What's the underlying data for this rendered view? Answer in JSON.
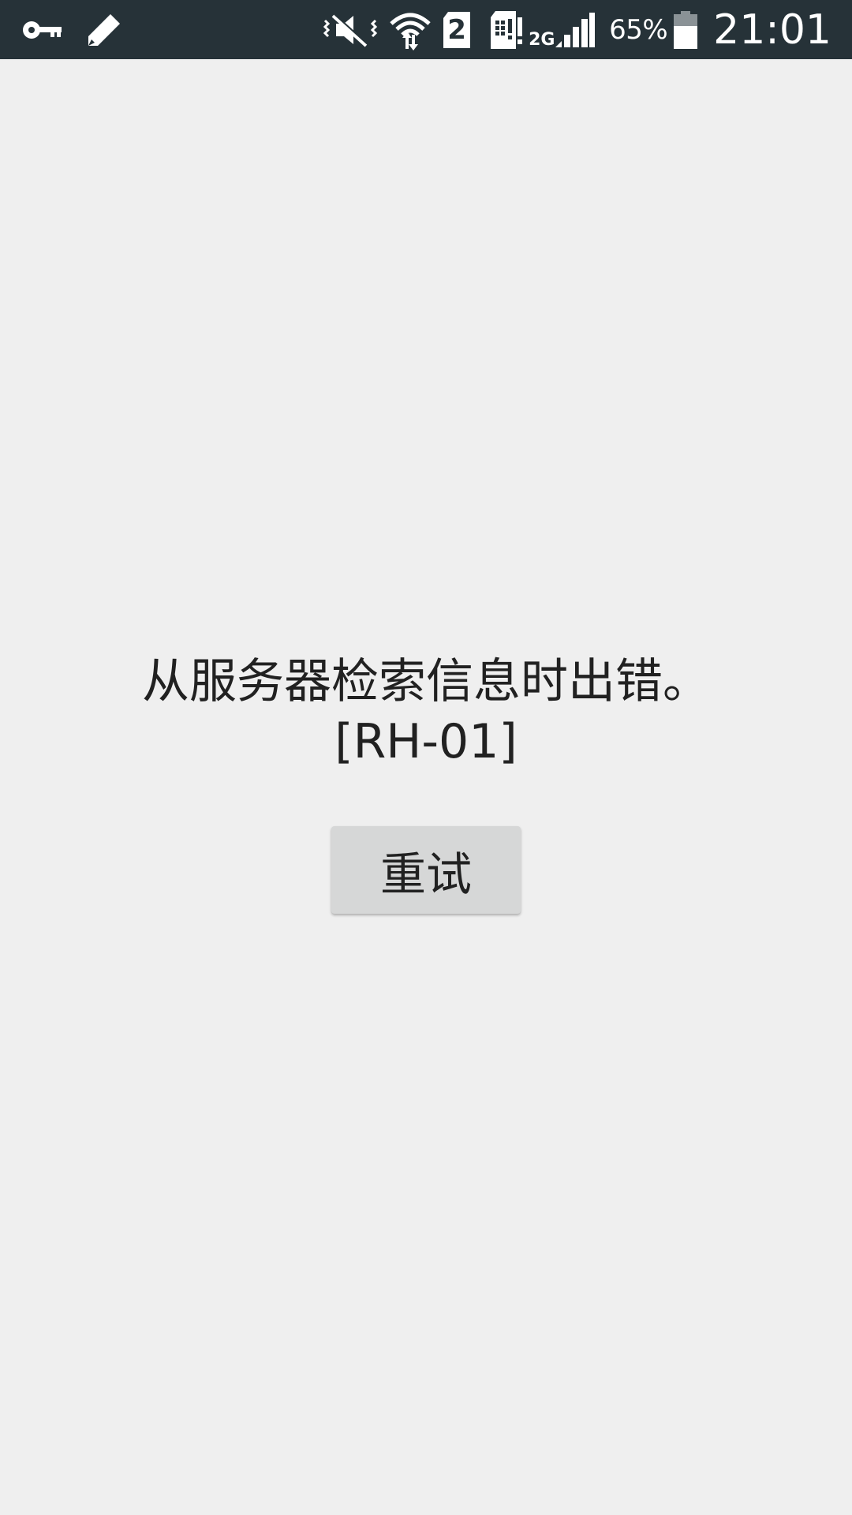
{
  "status_bar": {
    "left_icons": [
      "key-icon",
      "pencil-icon"
    ],
    "right_icons": [
      "vibrate-mute-icon",
      "wifi-icon",
      "sim-2-icon",
      "sim-card-alert-icon",
      "signal-2g-icon",
      "battery-icon"
    ],
    "sim_slot_label": "2",
    "network_type": "2G",
    "battery_percent": "65%",
    "battery_level": 0.65,
    "time": "21:01",
    "background_color": "#263238"
  },
  "main": {
    "error_line1": "从服务器检索信息时出错。",
    "error_line2": "[RH-01]",
    "retry_label": "重试",
    "background_color": "#efefef",
    "button_color": "#d6d7d7",
    "text_color": "#212121"
  }
}
